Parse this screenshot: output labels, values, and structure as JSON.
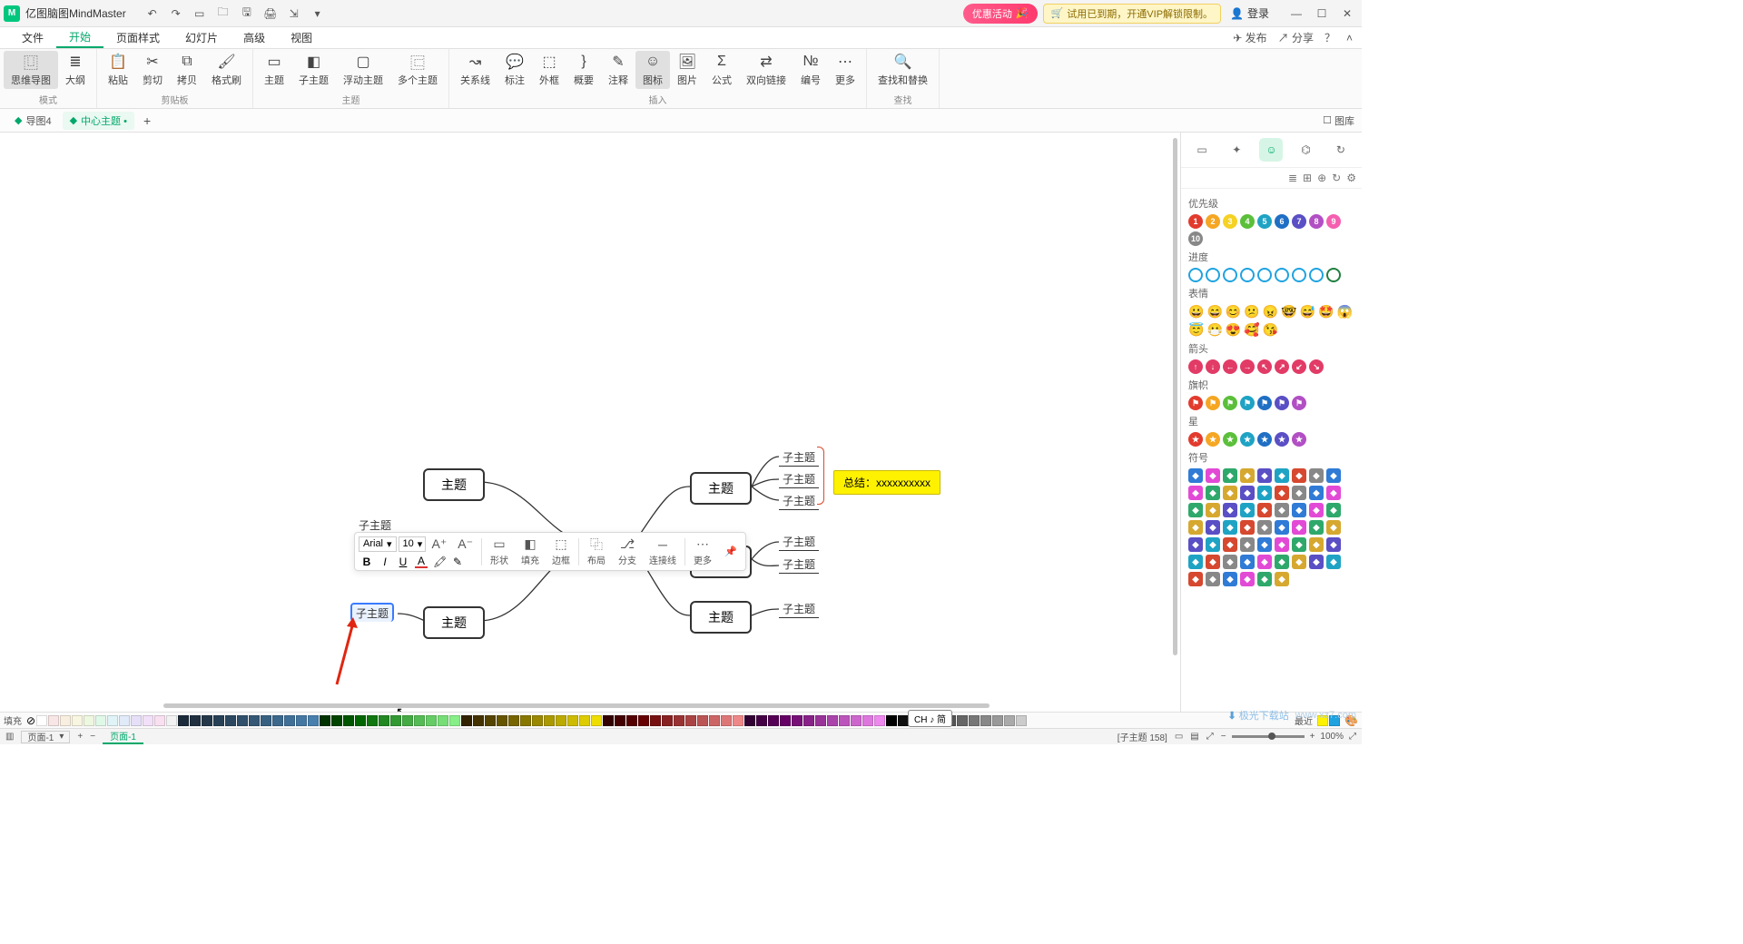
{
  "app": {
    "name": "亿图脑图MindMaster"
  },
  "titlebar": {
    "promo": "优惠活动",
    "trial": "试用已到期，开通VIP解锁限制。",
    "login": "登录"
  },
  "menu": {
    "items": [
      "文件",
      "开始",
      "页面样式",
      "幻灯片",
      "高级",
      "视图"
    ],
    "activeIndex": 1,
    "publish": "发布",
    "share": "分享"
  },
  "ribbon": {
    "groups": [
      {
        "name": "模式",
        "btns": [
          {
            "label": "思维导图",
            "icon": "⿶",
            "active": true
          },
          {
            "label": "大纲",
            "icon": "≣"
          }
        ]
      },
      {
        "name": "剪贴板",
        "btns": [
          {
            "label": "粘贴",
            "icon": "📋"
          },
          {
            "label": "剪切",
            "icon": "✂"
          },
          {
            "label": "拷贝",
            "icon": "⧉"
          },
          {
            "label": "格式刷",
            "icon": "🖌"
          }
        ]
      },
      {
        "name": "主题",
        "btns": [
          {
            "label": "主题",
            "icon": "▭"
          },
          {
            "label": "子主题",
            "icon": "◧"
          },
          {
            "label": "浮动主题",
            "icon": "▢"
          },
          {
            "label": "多个主题",
            "icon": "⿷"
          }
        ]
      },
      {
        "name": "插入",
        "btns": [
          {
            "label": "关系线",
            "icon": "↝"
          },
          {
            "label": "标注",
            "icon": "💬"
          },
          {
            "label": "外框",
            "icon": "⬚"
          },
          {
            "label": "概要",
            "icon": "}"
          },
          {
            "label": "注释",
            "icon": "✎"
          },
          {
            "label": "图标",
            "icon": "☺",
            "active": true
          },
          {
            "label": "图片",
            "icon": "🖼"
          },
          {
            "label": "公式",
            "icon": "Σ"
          },
          {
            "label": "双向链接",
            "icon": "⇄"
          },
          {
            "label": "编号",
            "icon": "№"
          },
          {
            "label": "更多",
            "icon": "⋯"
          }
        ]
      },
      {
        "name": "查找",
        "btns": [
          {
            "label": "查找和替换",
            "icon": "🔍"
          }
        ]
      }
    ]
  },
  "tabs": {
    "items": [
      {
        "label": "导图4",
        "dirty": false
      },
      {
        "label": "中心主题",
        "dirty": true
      }
    ],
    "activeIndex": 1,
    "rightToggle": "图库"
  },
  "rightPanel": {
    "sections": [
      {
        "name": "优先级",
        "type": "numbered",
        "colors": [
          "#e23b2e",
          "#f5a623",
          "#f5d223",
          "#5bbf3a",
          "#1fa3c4",
          "#1f6fc4",
          "#5a4fc4",
          "#b24fc4",
          "#f55fb0",
          "#888888"
        ],
        "labels": [
          "1",
          "2",
          "3",
          "4",
          "5",
          "6",
          "7",
          "8",
          "9",
          "10"
        ]
      },
      {
        "name": "进度",
        "type": "progress",
        "colors": [
          "#1fa3e0",
          "#1fa3e0",
          "#1fa3e0",
          "#1fa3e0",
          "#1fa3e0",
          "#1fa3e0",
          "#1fa3e0",
          "#1fa3e0",
          "#1f7f40"
        ]
      },
      {
        "name": "表情",
        "type": "emoji",
        "items": [
          "😀",
          "😄",
          "😊",
          "😕",
          "😠",
          "🤓",
          "😅",
          "🤩",
          "😱",
          "😇",
          "😷",
          "😍",
          "🥰",
          "😘"
        ]
      },
      {
        "name": "箭头",
        "type": "arrow",
        "colors": [
          "#e23b66",
          "#e23b66",
          "#e23b66",
          "#e23b66",
          "#e23b66",
          "#e23b66",
          "#e23b66",
          "#e23b66"
        ],
        "glyphs": [
          "↑",
          "↓",
          "←",
          "→",
          "↖",
          "↗",
          "↙",
          "↘"
        ]
      },
      {
        "name": "旗帜",
        "type": "flag",
        "colors": [
          "#e23b2e",
          "#f5a623",
          "#5bbf3a",
          "#1fa3c4",
          "#1f6fc4",
          "#5a4fc4",
          "#b24fc4"
        ]
      },
      {
        "name": "星",
        "type": "star",
        "colors": [
          "#e23b2e",
          "#f5a623",
          "#5bbf3a",
          "#1fa3c4",
          "#1f6fc4",
          "#5a4fc4",
          "#b24fc4"
        ]
      },
      {
        "name": "符号",
        "type": "symbol",
        "rows": 6,
        "perRow": 10
      }
    ]
  },
  "canvas": {
    "nodes": {
      "topicTL_label": "主题",
      "topicBL_label": "主题",
      "topicR1_label": "主题",
      "topicR2_label": "主题",
      "topicR3_label": "主题",
      "sub_selected": "子主题",
      "sub_r1a": "子主题",
      "sub_r1b": "子主题",
      "sub_r1c": "子主题",
      "sub_r2a": "子主题",
      "sub_r2b": "子主题",
      "sub_r3a": "子主题",
      "callout": "总结：xxxxxxxxxx",
      "peek": "子主题"
    },
    "floater": {
      "font": "Arial",
      "size": "10",
      "shape": "形状",
      "fill": "填充",
      "border": "边框",
      "layout": "布局",
      "branch": "分支",
      "connector": "连接线",
      "more": "更多"
    }
  },
  "colorbar": {
    "label": "填充",
    "recent": "最近",
    "swatches": [
      "#ffffff",
      "#f8e6e6",
      "#f8efe0",
      "#f8f6e0",
      "#eef8e0",
      "#e0f8e8",
      "#e0f4f8",
      "#e0eaf8",
      "#e5e0f8",
      "#f2e0f8",
      "#f8e0f0",
      "#f2f2f2",
      "#1b2b3a",
      "#203040",
      "#24384a",
      "#284055",
      "#2c4860",
      "#30506b",
      "#345876",
      "#386081",
      "#3c688c",
      "#406f97",
      "#4477a2",
      "#487fad",
      "#003300",
      "#004400",
      "#005500",
      "#006600",
      "#117711",
      "#228822",
      "#339933",
      "#44aa44",
      "#55bb55",
      "#66cc66",
      "#77dd77",
      "#88ee88",
      "#332200",
      "#443300",
      "#554400",
      "#665500",
      "#776600",
      "#887700",
      "#998800",
      "#aa9900",
      "#bbaa00",
      "#ccbb00",
      "#ddcc00",
      "#eedd00",
      "#330000",
      "#440000",
      "#550000",
      "#660000",
      "#771111",
      "#882222",
      "#993333",
      "#aa4444",
      "#bb5555",
      "#cc6666",
      "#dd7777",
      "#ee8888",
      "#330033",
      "#440044",
      "#550055",
      "#660066",
      "#771177",
      "#882288",
      "#993399",
      "#aa44aa",
      "#bb55bb",
      "#cc66cc",
      "#dd77dd",
      "#ee88ee",
      "#000000",
      "#111111",
      "#222222",
      "#333333",
      "#444444",
      "#555555",
      "#666666",
      "#777777",
      "#888888",
      "#999999",
      "#aaaaaa",
      "#cccccc"
    ]
  },
  "status": {
    "pageSel": "页面-1",
    "pageTab": "页面-1",
    "ime": "CH ♪ 简",
    "selection": "[子主题 158]",
    "zoom": "100%"
  },
  "watermark": {
    "brand": "极光下载站",
    "url": "www.xz7.com"
  }
}
